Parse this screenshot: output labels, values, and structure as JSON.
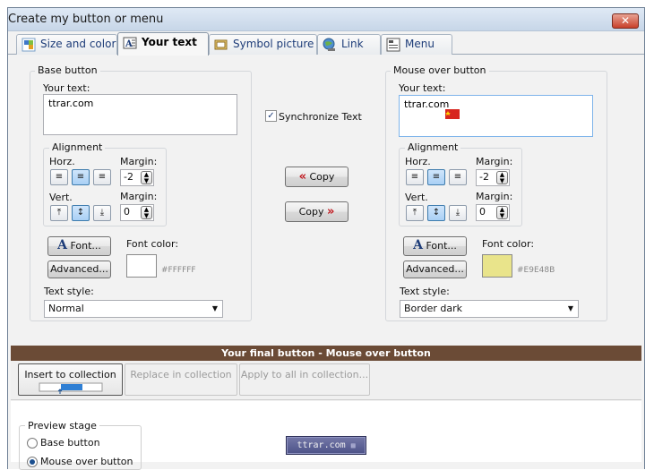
{
  "window": {
    "title": "Create my button or menu",
    "close_glyph": "✕"
  },
  "tabs": [
    {
      "label": "Size and color",
      "icon": "size-color-icon"
    },
    {
      "label": "Your text",
      "icon": "text-icon"
    },
    {
      "label": "Symbol picture",
      "icon": "picture-icon"
    },
    {
      "label": "Link",
      "icon": "globe-icon"
    },
    {
      "label": "Menu",
      "icon": "menu-icon"
    }
  ],
  "base": {
    "group_label": "Base button",
    "your_text_label": "Your text:",
    "text_value": "ttrar.com",
    "alignment_label": "Alignment",
    "horz_label": "Horz.",
    "vert_label": "Vert.",
    "margin_label": "Margin:",
    "horz_margin": "-2",
    "vert_margin": "0",
    "font_button": "Font...",
    "advanced_button": "Advanced...",
    "font_color_label": "Font color:",
    "font_color_hex": "#FFFFFF",
    "text_style_label": "Text style:",
    "text_style_value": "Normal"
  },
  "mouseover": {
    "group_label": "Mouse over button",
    "your_text_label": "Your text:",
    "text_value": "ttrar.com",
    "alignment_label": "Alignment",
    "horz_label": "Horz.",
    "vert_label": "Vert.",
    "margin_label": "Margin:",
    "horz_margin": "-2",
    "vert_margin": "0",
    "font_button": "Font...",
    "advanced_button": "Advanced...",
    "font_color_label": "Font color:",
    "font_color_hex": "#E9E48B",
    "text_style_label": "Text style:",
    "text_style_value": "Border dark"
  },
  "middle": {
    "synchronize_label": "Synchronize Text",
    "synchronize_checked": true,
    "copy_left_label": "Copy",
    "copy_left_arrows": "«",
    "copy_right_label": "Copy",
    "copy_right_arrows": "»"
  },
  "final": {
    "bar_title": "Your final button - Mouse over button",
    "insert_label": "Insert to collection",
    "replace_label": "Replace in collection",
    "apply_label": "Apply to all in collection..."
  },
  "preview": {
    "stage_label": "Preview stage",
    "option_base": "Base button",
    "option_mouseover": "Mouse over button",
    "button_text": "ttrar.com"
  },
  "colors": {
    "base_font_color": "#FFFFFF",
    "mouseover_font_color": "#E9E48B",
    "bar_color": "#6B4B36",
    "preview_button": "#5B5F94"
  }
}
